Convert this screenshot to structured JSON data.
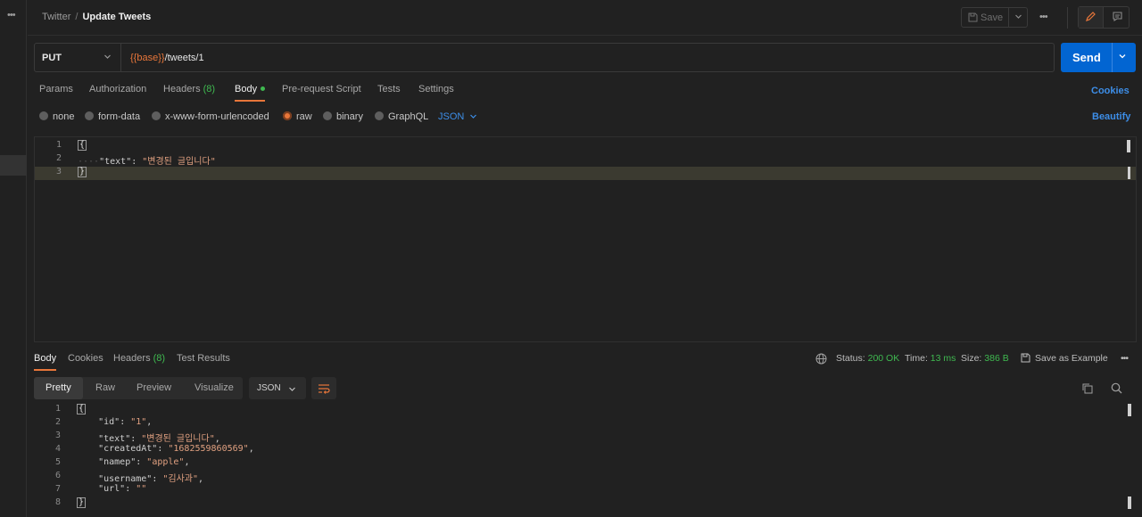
{
  "rail": {
    "menu": "•••"
  },
  "breadcrumb": {
    "collection": "Twitter",
    "separator": "/",
    "request": "Update Tweets"
  },
  "toolbar": {
    "save_label": "Save",
    "more": "•••"
  },
  "request": {
    "method": "PUT",
    "url_var": "{{base}}",
    "url_path": "/tweets/1",
    "send_label": "Send"
  },
  "request_tabs": [
    {
      "label": "Params"
    },
    {
      "label": "Authorization"
    },
    {
      "label": "Headers",
      "count": "(8)"
    },
    {
      "label": "Body"
    },
    {
      "label": "Pre-request Script"
    },
    {
      "label": "Tests"
    },
    {
      "label": "Settings"
    }
  ],
  "cookies_label": "Cookies",
  "body_types": [
    {
      "label": "none"
    },
    {
      "label": "form-data"
    },
    {
      "label": "x-www-form-urlencoded"
    },
    {
      "label": "raw"
    },
    {
      "label": "binary"
    },
    {
      "label": "GraphQL"
    }
  ],
  "body_format": "JSON",
  "beautify_label": "Beautify",
  "request_body": {
    "line_numbers": [
      "1",
      "2",
      "3"
    ],
    "open": "{",
    "key": "\"text\"",
    "colon": ": ",
    "value": "\"변경된 글입니다\"",
    "close": "}",
    "indent": "····"
  },
  "response_tabs": [
    {
      "label": "Body"
    },
    {
      "label": "Cookies"
    },
    {
      "label": "Headers",
      "count": "(8)"
    },
    {
      "label": "Test Results"
    }
  ],
  "response_meta": {
    "status_label": "Status:",
    "status_value": "200 OK",
    "time_label": "Time:",
    "time_value": "13 ms",
    "size_label": "Size:",
    "size_value": "386 B",
    "save_example": "Save as Example",
    "more": "•••"
  },
  "response_formats": [
    {
      "label": "Pretty"
    },
    {
      "label": "Raw"
    },
    {
      "label": "Preview"
    },
    {
      "label": "Visualize"
    }
  ],
  "response_format_select": "JSON",
  "response_body": {
    "line_numbers": [
      "1",
      "2",
      "3",
      "4",
      "5",
      "6",
      "7",
      "8"
    ],
    "open": "{",
    "close": "}",
    "fields": [
      {
        "key": "\"id\"",
        "value": "\"1\"",
        "comma": ","
      },
      {
        "key": "\"text\"",
        "value": "\"변경된 글입니다\"",
        "comma": ","
      },
      {
        "key": "\"createdAt\"",
        "value": "\"1682559860569\"",
        "comma": ","
      },
      {
        "key": "\"namep\"",
        "value": "\"apple\"",
        "comma": ","
      },
      {
        "key": "\"username\"",
        "value": "\"김사과\"",
        "comma": ","
      },
      {
        "key": "\"url\"",
        "value": "\"\"",
        "comma": ""
      }
    ]
  }
}
